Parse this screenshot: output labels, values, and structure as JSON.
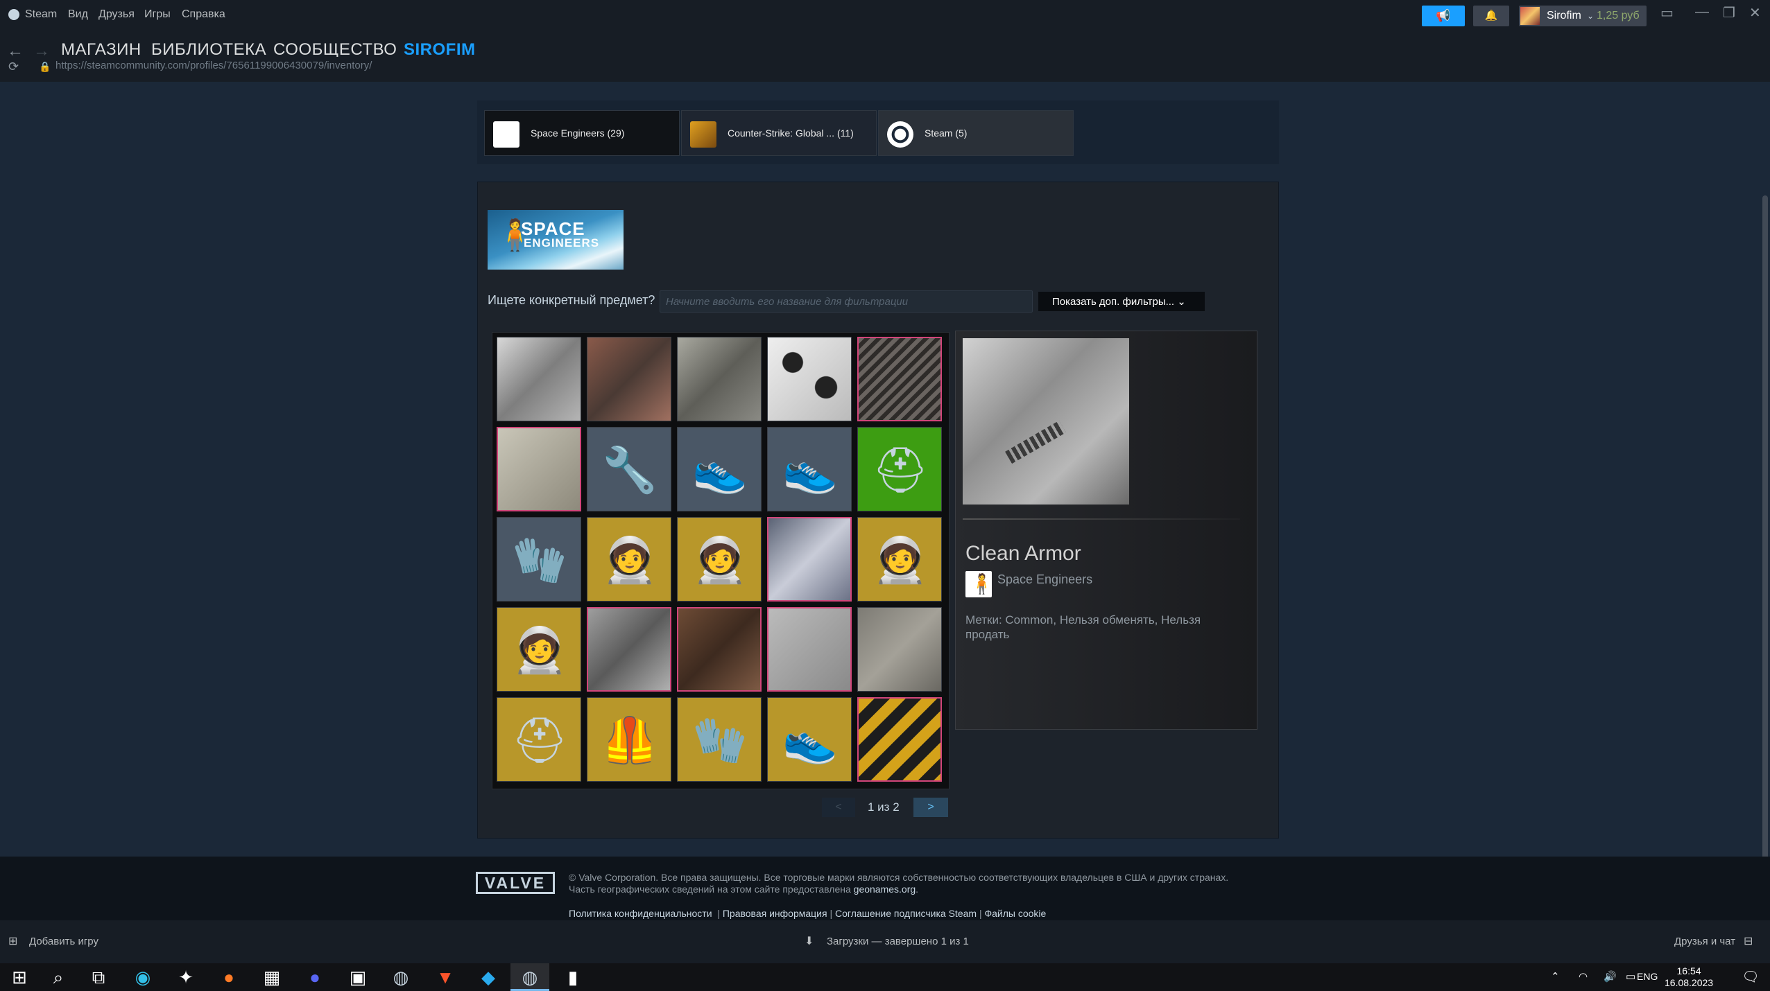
{
  "titlebar": {
    "app_name": "Steam",
    "menu": [
      "Вид",
      "Друзья",
      "Игры",
      "Справка"
    ],
    "username": "Sirofim",
    "wallet": "1,25 руб"
  },
  "nav": {
    "links": [
      "МАГАЗИН",
      "БИБЛИОТЕКА",
      "СООБЩЕСТВО",
      "SIROFIM"
    ],
    "url": "https://steamcommunity.com/profiles/76561199006430079/inventory/"
  },
  "game_tabs": [
    {
      "label": "Space Engineers (29)",
      "active": true
    },
    {
      "label": "Counter-Strike: Global ...  (11)",
      "active": false
    },
    {
      "label": "Steam (5)",
      "active": false
    }
  ],
  "banner": {
    "line1": "SPACE",
    "line2": "ENGINEERS"
  },
  "search": {
    "label": "Ищете конкретный предмет?",
    "placeholder": "Начните вводить его название для фильтрации",
    "filters_button": "Показать доп. фильтры...  ⌄"
  },
  "inventory_items": [
    {
      "bg": "linear-gradient(135deg,#d8d8d8,#7e7e7e 50%,#b5b5b5)",
      "icon": "",
      "pink": false
    },
    {
      "bg": "linear-gradient(135deg,#8a5a4a,#4a3a34 50%,#a07060)",
      "icon": "",
      "pink": false
    },
    {
      "bg": "linear-gradient(135deg,#a9a9a0,#5e5e58 50%,#8a8a84)",
      "icon": "",
      "pink": false
    },
    {
      "bg": "radial-gradient(circle at 30% 30%,#222 12%,transparent 13%),radial-gradient(circle at 70% 60%,#222 14%,transparent 15%),linear-gradient(135deg,#eee,#bbb)",
      "icon": "",
      "pink": false
    },
    {
      "bg": "repeating-linear-gradient(135deg,#6a6460 0 6px,#2e2b29 6px 12px)",
      "icon": "",
      "pink": true
    },
    {
      "bg": "linear-gradient(135deg,#c9c6b8,#8e8a7c)",
      "icon": "",
      "pink": true
    },
    {
      "bg": "#4a5766",
      "icon": "🔧",
      "pink": false
    },
    {
      "bg": "#4a5766",
      "icon": "👟",
      "pink": false
    },
    {
      "bg": "#4a5766",
      "icon": "👟",
      "pink": false
    },
    {
      "bg": "#3d9d12",
      "icon": "⛑",
      "pink": false
    },
    {
      "bg": "#4a5766",
      "icon": "🧤",
      "pink": false
    },
    {
      "bg": "#b8972a",
      "icon": "🧑‍🚀",
      "pink": false
    },
    {
      "bg": "#b8972a",
      "icon": "🧑‍🚀",
      "pink": false
    },
    {
      "bg": "linear-gradient(135deg,#5b6375,#c9ccd8 50%,#6c7287)",
      "icon": "",
      "pink": true
    },
    {
      "bg": "#b8972a",
      "icon": "🧑‍🚀",
      "pink": false
    },
    {
      "bg": "#b8972a",
      "icon": "🧑‍🚀",
      "pink": false
    },
    {
      "bg": "linear-gradient(135deg,#9e9e9e,#5a5a5a 50%,#b0b0b0)",
      "icon": "",
      "pink": true
    },
    {
      "bg": "linear-gradient(135deg,#6d4b35,#3d2a1f 50%,#7e5a44)",
      "icon": "",
      "pink": true
    },
    {
      "bg": "linear-gradient(135deg,#bbbbbb,#8a8a8a)",
      "icon": "",
      "pink": true
    },
    {
      "bg": "linear-gradient(135deg,#7d7b74,#a4a198 50%,#6a6862)",
      "icon": "",
      "pink": false
    },
    {
      "bg": "#b8972a",
      "icon": "⛑",
      "pink": false
    },
    {
      "bg": "#b8972a",
      "icon": "🦺",
      "pink": false
    },
    {
      "bg": "#b8972a",
      "icon": "🧤",
      "pink": false
    },
    {
      "bg": "#b8972a",
      "icon": "👟",
      "pink": false
    },
    {
      "bg": "repeating-linear-gradient(135deg,#d4a21a 0 16px,#1d1d1d 16px 32px)",
      "icon": "",
      "pink": true
    }
  ],
  "pager": {
    "prev": "<",
    "info": "1 из 2",
    "next": ">"
  },
  "detail": {
    "name": "Clean Armor",
    "game": "Space Engineers",
    "tags": "Метки: Common, Нельзя обменять, Нельзя продать"
  },
  "footer": {
    "logo": "VALVE",
    "copyright_line1": "© Valve Corporation. Все права защищены. Все торговые марки являются собственностью соответствующих владельцев в США и других странах.",
    "copyright_line2": "Часть географических сведений на этом сайте предоставлена",
    "geonames": "geonames.org",
    "links": [
      "Политика конфиденциальности",
      "Правовая информация",
      "Соглашение подписчика Steam",
      "Файлы cookie"
    ]
  },
  "bottom_bar": {
    "add_game": "Добавить игру",
    "downloads": "Загрузки — завершено 1 из 1",
    "friends": "Друзья и чат"
  },
  "tray": {
    "lang": "ENG",
    "time": "16:54",
    "date": "16.08.2023"
  }
}
